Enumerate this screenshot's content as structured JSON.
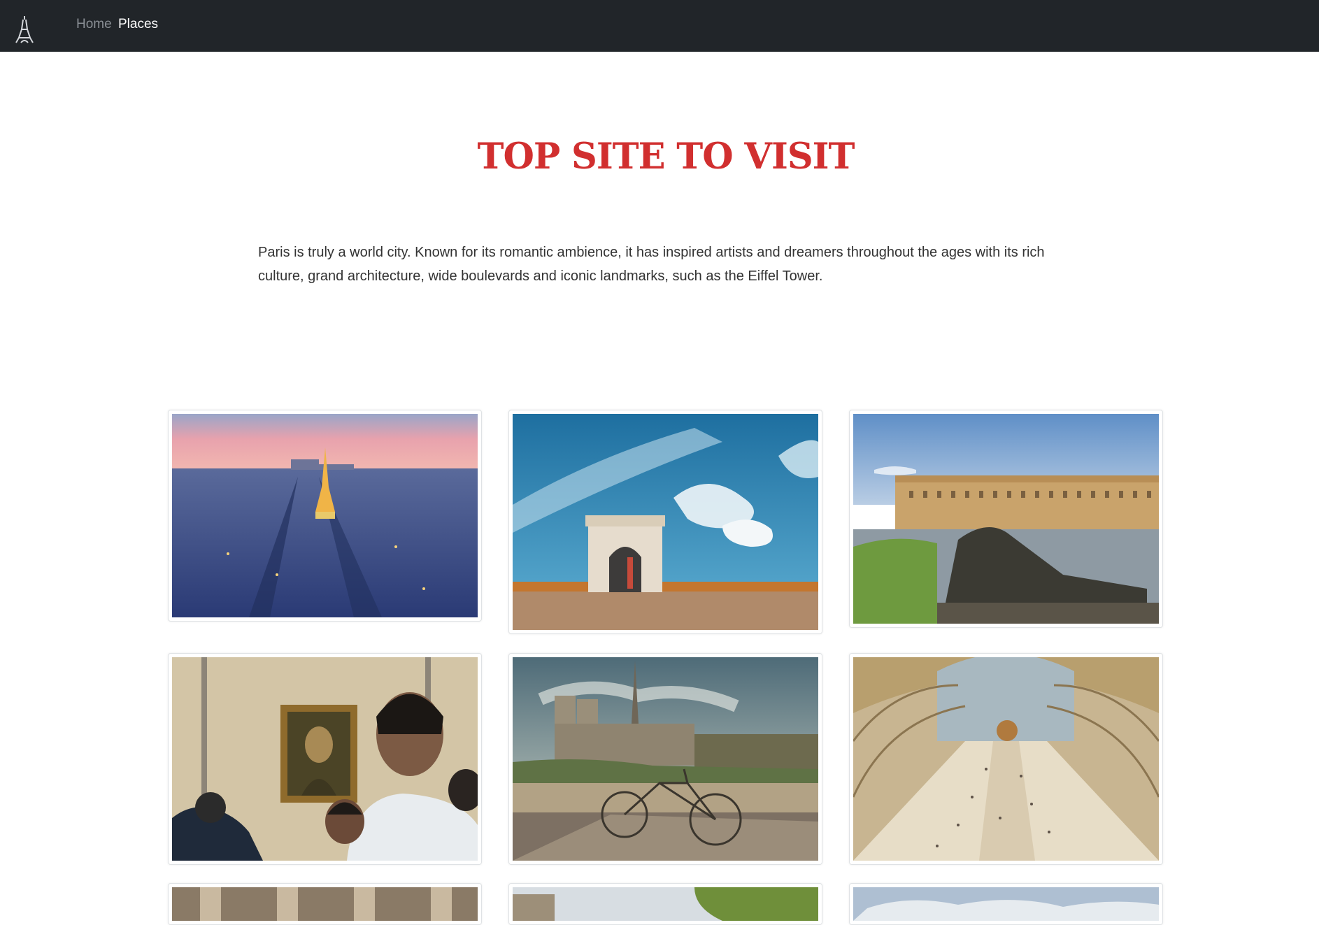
{
  "navbar": {
    "brand_icon": "eiffel-tower-icon",
    "links": [
      {
        "label": "Home",
        "active": false
      },
      {
        "label": "Places",
        "active": true
      }
    ]
  },
  "hero": {
    "title": "TOP SITE TO VISIT",
    "intro": "Paris is truly a world city. Known for its romantic ambience, it has inspired artists and dreamers throughout the ages with its rich culture, grand architecture, wide boulevards and iconic landmarks, such as the Eiffel Tower."
  },
  "colors": {
    "navbar_bg": "#212529",
    "title_red": "#d12f2f",
    "text": "#333333"
  },
  "gallery": {
    "photos": [
      "eiffel-tower-cityscape-photo",
      "arc-de-triomphe-photo",
      "versailles-palace-statue-photo",
      "mona-lisa-louvre-photo",
      "notre-dame-bicycle-photo",
      "musee-dorsay-hall-photo",
      "columns-photo",
      "tree-building-photo",
      "sky-photo"
    ]
  }
}
